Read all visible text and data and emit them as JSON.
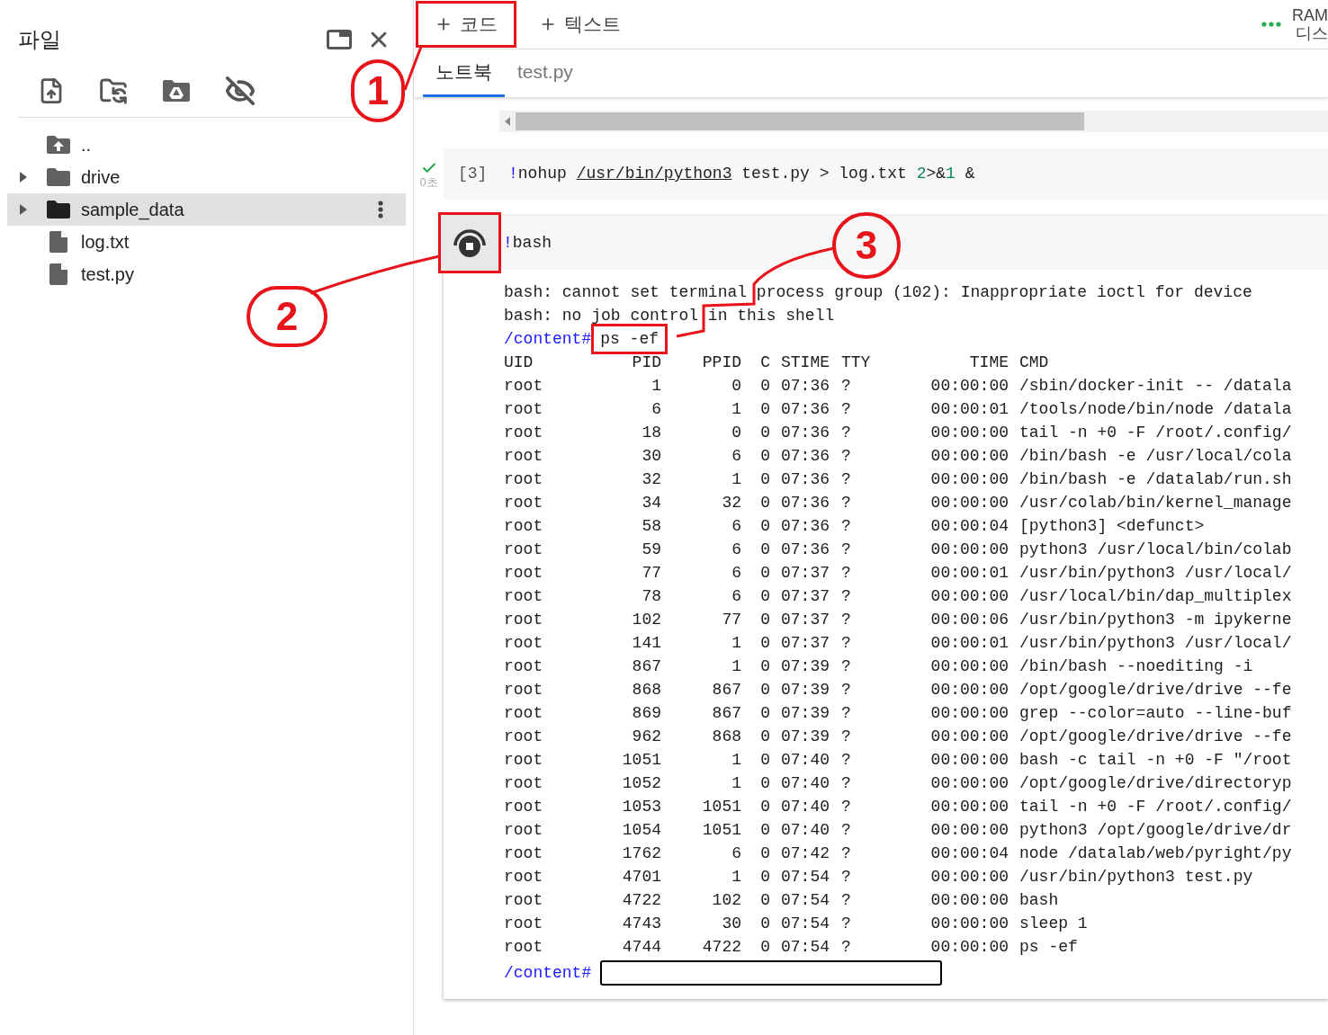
{
  "sidebar": {
    "title": "파일",
    "tree": [
      {
        "kind": "parent",
        "name": "..",
        "selected": false
      },
      {
        "kind": "folder",
        "name": "drive",
        "selected": false,
        "expanded": false
      },
      {
        "kind": "folder",
        "name": "sample_data",
        "selected": true,
        "expanded": false
      },
      {
        "kind": "file",
        "name": "log.txt",
        "selected": false
      },
      {
        "kind": "file",
        "name": "test.py",
        "selected": false
      }
    ]
  },
  "toolbar": {
    "buttons": [
      {
        "label": "코드",
        "highlighted": true
      },
      {
        "label": "텍스트",
        "highlighted": false
      }
    ],
    "resources": [
      "RAM",
      "디스"
    ]
  },
  "tabs": [
    {
      "label": "노트북",
      "selected": true
    },
    {
      "label": "test.py",
      "selected": false
    }
  ],
  "executed_cell": {
    "count": "[3]",
    "elapsed": "0초",
    "code": [
      {
        "kind": "bang",
        "text": "!"
      },
      {
        "kind": "plain",
        "text": "nohup "
      },
      {
        "kind": "path",
        "text": "/usr/bin/python3"
      },
      {
        "kind": "plain",
        "text": " test.py > log.txt "
      },
      {
        "kind": "number",
        "text": "2"
      },
      {
        "kind": "plain",
        "text": ">&"
      },
      {
        "kind": "number",
        "text": "1"
      },
      {
        "kind": "plain",
        "text": " &"
      }
    ]
  },
  "terminal_cell": {
    "run_button": {
      "highlighted": true
    },
    "code": [
      {
        "kind": "bang",
        "text": "!"
      },
      {
        "kind": "plain",
        "text": "bash"
      }
    ],
    "messages": [
      "bash: cannot set terminal process group (102): Inappropriate ioctl for device",
      "bash: no job control in this shell"
    ],
    "prompt": "/content#",
    "command": {
      "text": "ps -ef",
      "highlighted": true
    },
    "table": {
      "columns": [
        "UID",
        "PID",
        "PPID",
        "C",
        "STIME",
        "TTY",
        "TIME",
        "CMD"
      ],
      "rows": [
        [
          "root",
          "1",
          "0",
          "0",
          "07:36",
          "?",
          "00:00:00",
          "/sbin/docker-init -- /datala"
        ],
        [
          "root",
          "6",
          "1",
          "0",
          "07:36",
          "?",
          "00:00:01",
          "/tools/node/bin/node /datala"
        ],
        [
          "root",
          "18",
          "0",
          "0",
          "07:36",
          "?",
          "00:00:00",
          "tail -n +0 -F /root/.config/"
        ],
        [
          "root",
          "30",
          "6",
          "0",
          "07:36",
          "?",
          "00:00:00",
          "/bin/bash -e /usr/local/cola"
        ],
        [
          "root",
          "32",
          "1",
          "0",
          "07:36",
          "?",
          "00:00:00",
          "/bin/bash -e /datalab/run.sh"
        ],
        [
          "root",
          "34",
          "32",
          "0",
          "07:36",
          "?",
          "00:00:00",
          "/usr/colab/bin/kernel_manage"
        ],
        [
          "root",
          "58",
          "6",
          "0",
          "07:36",
          "?",
          "00:00:04",
          "[python3] <defunct>"
        ],
        [
          "root",
          "59",
          "6",
          "0",
          "07:36",
          "?",
          "00:00:00",
          "python3 /usr/local/bin/colab"
        ],
        [
          "root",
          "77",
          "6",
          "0",
          "07:37",
          "?",
          "00:00:01",
          "/usr/bin/python3 /usr/local/"
        ],
        [
          "root",
          "78",
          "6",
          "0",
          "07:37",
          "?",
          "00:00:00",
          "/usr/local/bin/dap_multiplex"
        ],
        [
          "root",
          "102",
          "77",
          "0",
          "07:37",
          "?",
          "00:00:06",
          "/usr/bin/python3 -m ipykerne"
        ],
        [
          "root",
          "141",
          "1",
          "0",
          "07:37",
          "?",
          "00:00:01",
          "/usr/bin/python3 /usr/local/"
        ],
        [
          "root",
          "867",
          "1",
          "0",
          "07:39",
          "?",
          "00:00:00",
          "/bin/bash --noediting -i"
        ],
        [
          "root",
          "868",
          "867",
          "0",
          "07:39",
          "?",
          "00:00:00",
          "/opt/google/drive/drive --fe"
        ],
        [
          "root",
          "869",
          "867",
          "0",
          "07:39",
          "?",
          "00:00:00",
          "grep --color=auto --line-buf"
        ],
        [
          "root",
          "962",
          "868",
          "0",
          "07:39",
          "?",
          "00:00:00",
          "/opt/google/drive/drive --fe"
        ],
        [
          "root",
          "1051",
          "1",
          "0",
          "07:40",
          "?",
          "00:00:00",
          "bash -c tail -n +0 -F \"/root"
        ],
        [
          "root",
          "1052",
          "1",
          "0",
          "07:40",
          "?",
          "00:00:00",
          "/opt/google/drive/directoryp"
        ],
        [
          "root",
          "1053",
          "1051",
          "0",
          "07:40",
          "?",
          "00:00:00",
          "tail -n +0 -F /root/.config/"
        ],
        [
          "root",
          "1054",
          "1051",
          "0",
          "07:40",
          "?",
          "00:00:00",
          "python3 /opt/google/drive/dr"
        ],
        [
          "root",
          "1762",
          "6",
          "0",
          "07:42",
          "?",
          "00:00:04",
          "node /datalab/web/pyright/py"
        ],
        [
          "root",
          "4701",
          "1",
          "0",
          "07:54",
          "?",
          "00:00:00",
          "/usr/bin/python3 test.py"
        ],
        [
          "root",
          "4722",
          "102",
          "0",
          "07:54",
          "?",
          "00:00:00",
          "bash"
        ],
        [
          "root",
          "4743",
          "30",
          "0",
          "07:54",
          "?",
          "00:00:00",
          "sleep 1"
        ],
        [
          "root",
          "4744",
          "4722",
          "0",
          "07:54",
          "?",
          "00:00:00",
          "ps -ef"
        ]
      ]
    },
    "final_prompt": "/content#"
  },
  "annotations": [
    {
      "label": "1"
    },
    {
      "label": "2"
    },
    {
      "label": "3"
    }
  ]
}
